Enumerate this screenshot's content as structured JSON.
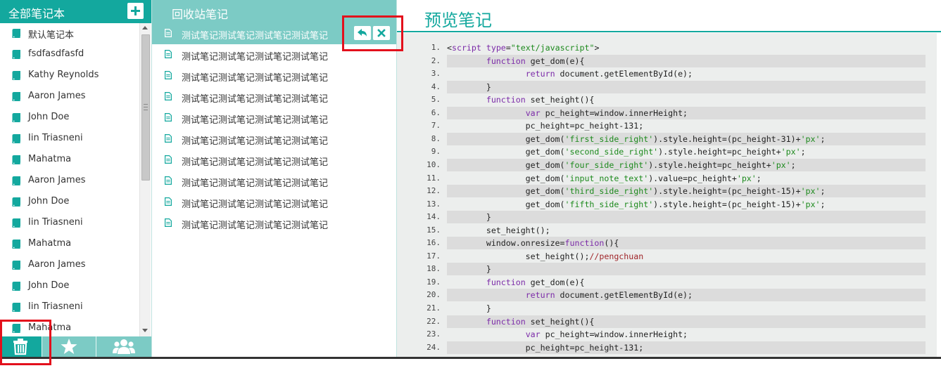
{
  "sidebar": {
    "title": "全部笔记本",
    "add_icon": "plus-icon",
    "notebooks": [
      "默认笔记本",
      "fsdfasdfasfd",
      "Kathy Reynolds",
      "Aaron James",
      "John Doe",
      "Iin Triasneni",
      "Mahatma",
      "Aaron James",
      "John Doe",
      "Iin Triasneni",
      "Mahatma",
      "Aaron James",
      "John Doe",
      "Iin Triasneni",
      "Mahatma"
    ],
    "notebook_icon": "book-icon",
    "toolbar": [
      "trash-icon",
      "star-icon",
      "group-icon"
    ]
  },
  "recycle": {
    "title": "回收站笔记",
    "note_icon": "document-icon",
    "notes": [
      "测试笔记测试笔记测试笔记测试笔记",
      "测试笔记测试笔记测试笔记测试笔记",
      "测试笔记测试笔记测试笔记测试笔记",
      "测试笔记测试笔记测试笔记测试笔记",
      "测试笔记测试笔记测试笔记测试笔记",
      "测试笔记测试笔记测试笔记测试笔记",
      "测试笔记测试笔记测试笔记测试笔记",
      "测试笔记测试笔记测试笔记测试笔记",
      "测试笔记测试笔记测试笔记测试笔记",
      "测试笔记测试笔记测试笔记测试笔记"
    ],
    "selected_index": 0,
    "actions": [
      "undo-icon",
      "close-icon"
    ]
  },
  "preview": {
    "title": "预览笔记",
    "line_numbers": [
      "1.",
      "2.",
      "3.",
      "4.",
      "5.",
      "6.",
      "7.",
      "8.",
      "9.",
      "10.",
      "11.",
      "12.",
      "13.",
      "14.",
      "15.",
      "16.",
      "17.",
      "18.",
      "19.",
      "20.",
      "21.",
      "22.",
      "23.",
      "24."
    ],
    "code_lines": [
      "<script type=\"text/javascript\">",
      "        function get_dom(e){",
      "                return document.getElementById(e);",
      "        }",
      "        function set_height(){",
      "                var pc_height=window.innerHeight;",
      "                pc_height=pc_height-131;",
      "                get_dom('first_side_right').style.height=(pc_height-31)+'px';",
      "                get_dom('second_side_right').style.height=pc_height+'px';",
      "                get_dom('four_side_right').style.height=pc_height+'px';",
      "                get_dom('input_note_text').value=pc_height+'px';",
      "                get_dom('third_side_right').style.height=(pc_height-15)+'px';",
      "                get_dom('fifth_side_right').style.height=(pc_height-15)+'px';",
      "        }",
      "        set_height();",
      "        window.onresize=function(){",
      "                set_height();//pengchuan",
      "        }",
      "        function get_dom(e){",
      "                return document.getElementById(e);",
      "        }",
      "        function set_height(){",
      "                var pc_height=window.innerHeight;",
      "                pc_height=pc_height-131;"
    ]
  },
  "colors": {
    "accent": "#13a89e",
    "accent_light": "#7ccbc5",
    "highlight_box": "#e3101c"
  }
}
